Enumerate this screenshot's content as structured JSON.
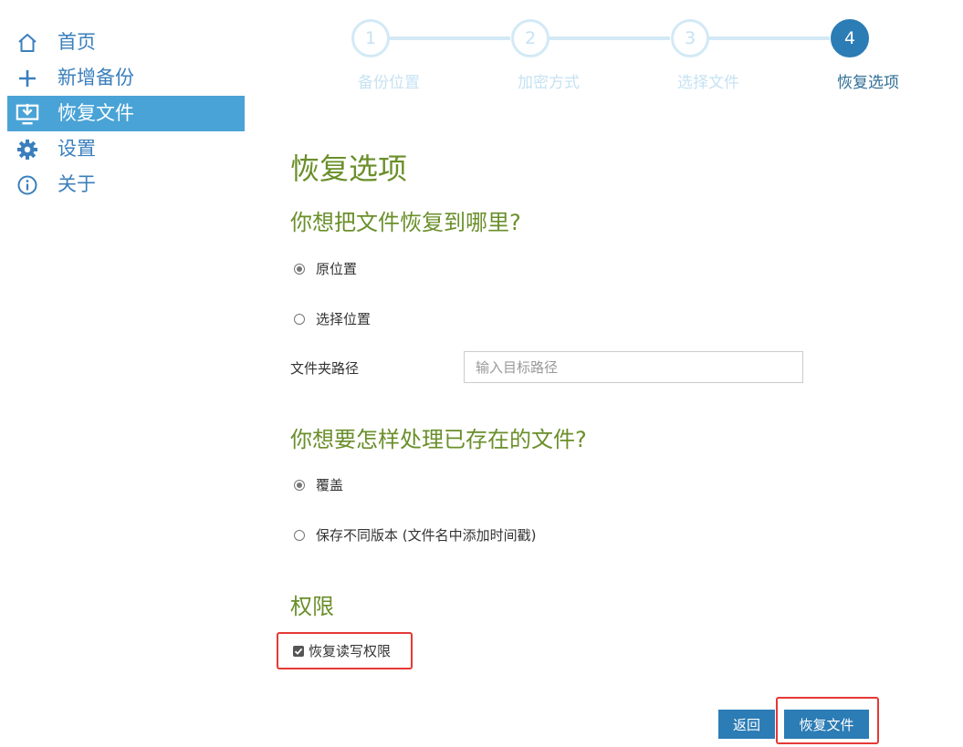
{
  "sidebar": {
    "items": [
      {
        "label": "首页",
        "icon": "home-icon"
      },
      {
        "label": "新增备份",
        "icon": "plus-icon"
      },
      {
        "label": "恢复文件",
        "icon": "restore-icon",
        "active": true
      },
      {
        "label": "设置",
        "icon": "gear-icon"
      },
      {
        "label": "关于",
        "icon": "info-icon"
      }
    ]
  },
  "stepper": {
    "steps": [
      {
        "number": "1",
        "label": "备份位置"
      },
      {
        "number": "2",
        "label": "加密方式"
      },
      {
        "number": "3",
        "label": "选择文件"
      },
      {
        "number": "4",
        "label": "恢复选项",
        "current": true
      }
    ]
  },
  "page": {
    "title": "恢复选项",
    "location_question": "你想把文件恢复到哪里?",
    "location_options": [
      "原位置",
      "选择位置"
    ],
    "location_selected": "原位置",
    "folder_path_label": "文件夹路径",
    "folder_path_placeholder": "输入目标路径",
    "folder_path_value": "",
    "existing_question": "你想要怎样处理已存在的文件?",
    "existing_options": [
      "覆盖",
      "保存不同版本 (文件名中添加时间戳)"
    ],
    "existing_selected": "覆盖",
    "permissions_heading": "权限",
    "restore_permissions_label": "恢复读写权限",
    "restore_permissions_checked": true
  },
  "buttons": {
    "back": "返回",
    "restore": "恢复文件"
  },
  "colors": {
    "accent": "#2c7cb5",
    "sidebar_active": "#4aa3d6",
    "heading_green": "#6a8f2a",
    "highlight_red": "#e53935"
  }
}
